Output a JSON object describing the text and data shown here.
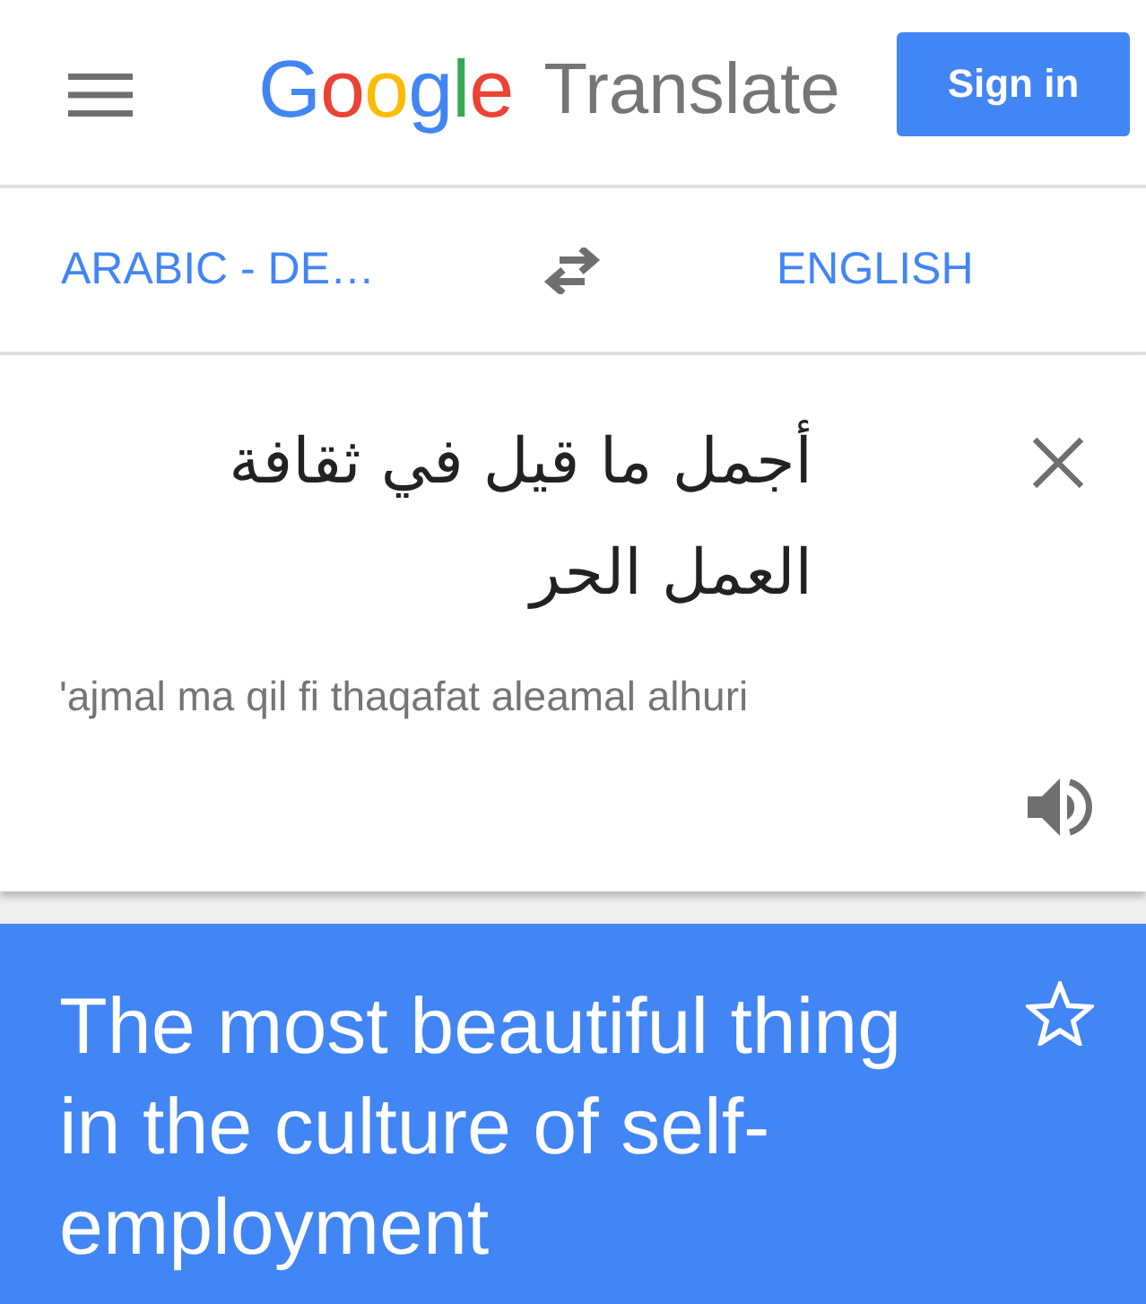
{
  "app_bar": {
    "logo": "Google",
    "title": "Translate",
    "sign_in_button": "Sign in"
  },
  "language_bar": {
    "source_language": "ARABIC - DE…",
    "target_language": "ENGLISH"
  },
  "input_card": {
    "source_text": "أجمل ما قيل في ثقافة العمل الحر",
    "transliteration": "'ajmal ma qil fi thaqafat aleamal alhuri"
  },
  "result_card": {
    "translation": "The most beautiful thing in the culture of self-employment",
    "starred": false
  }
}
